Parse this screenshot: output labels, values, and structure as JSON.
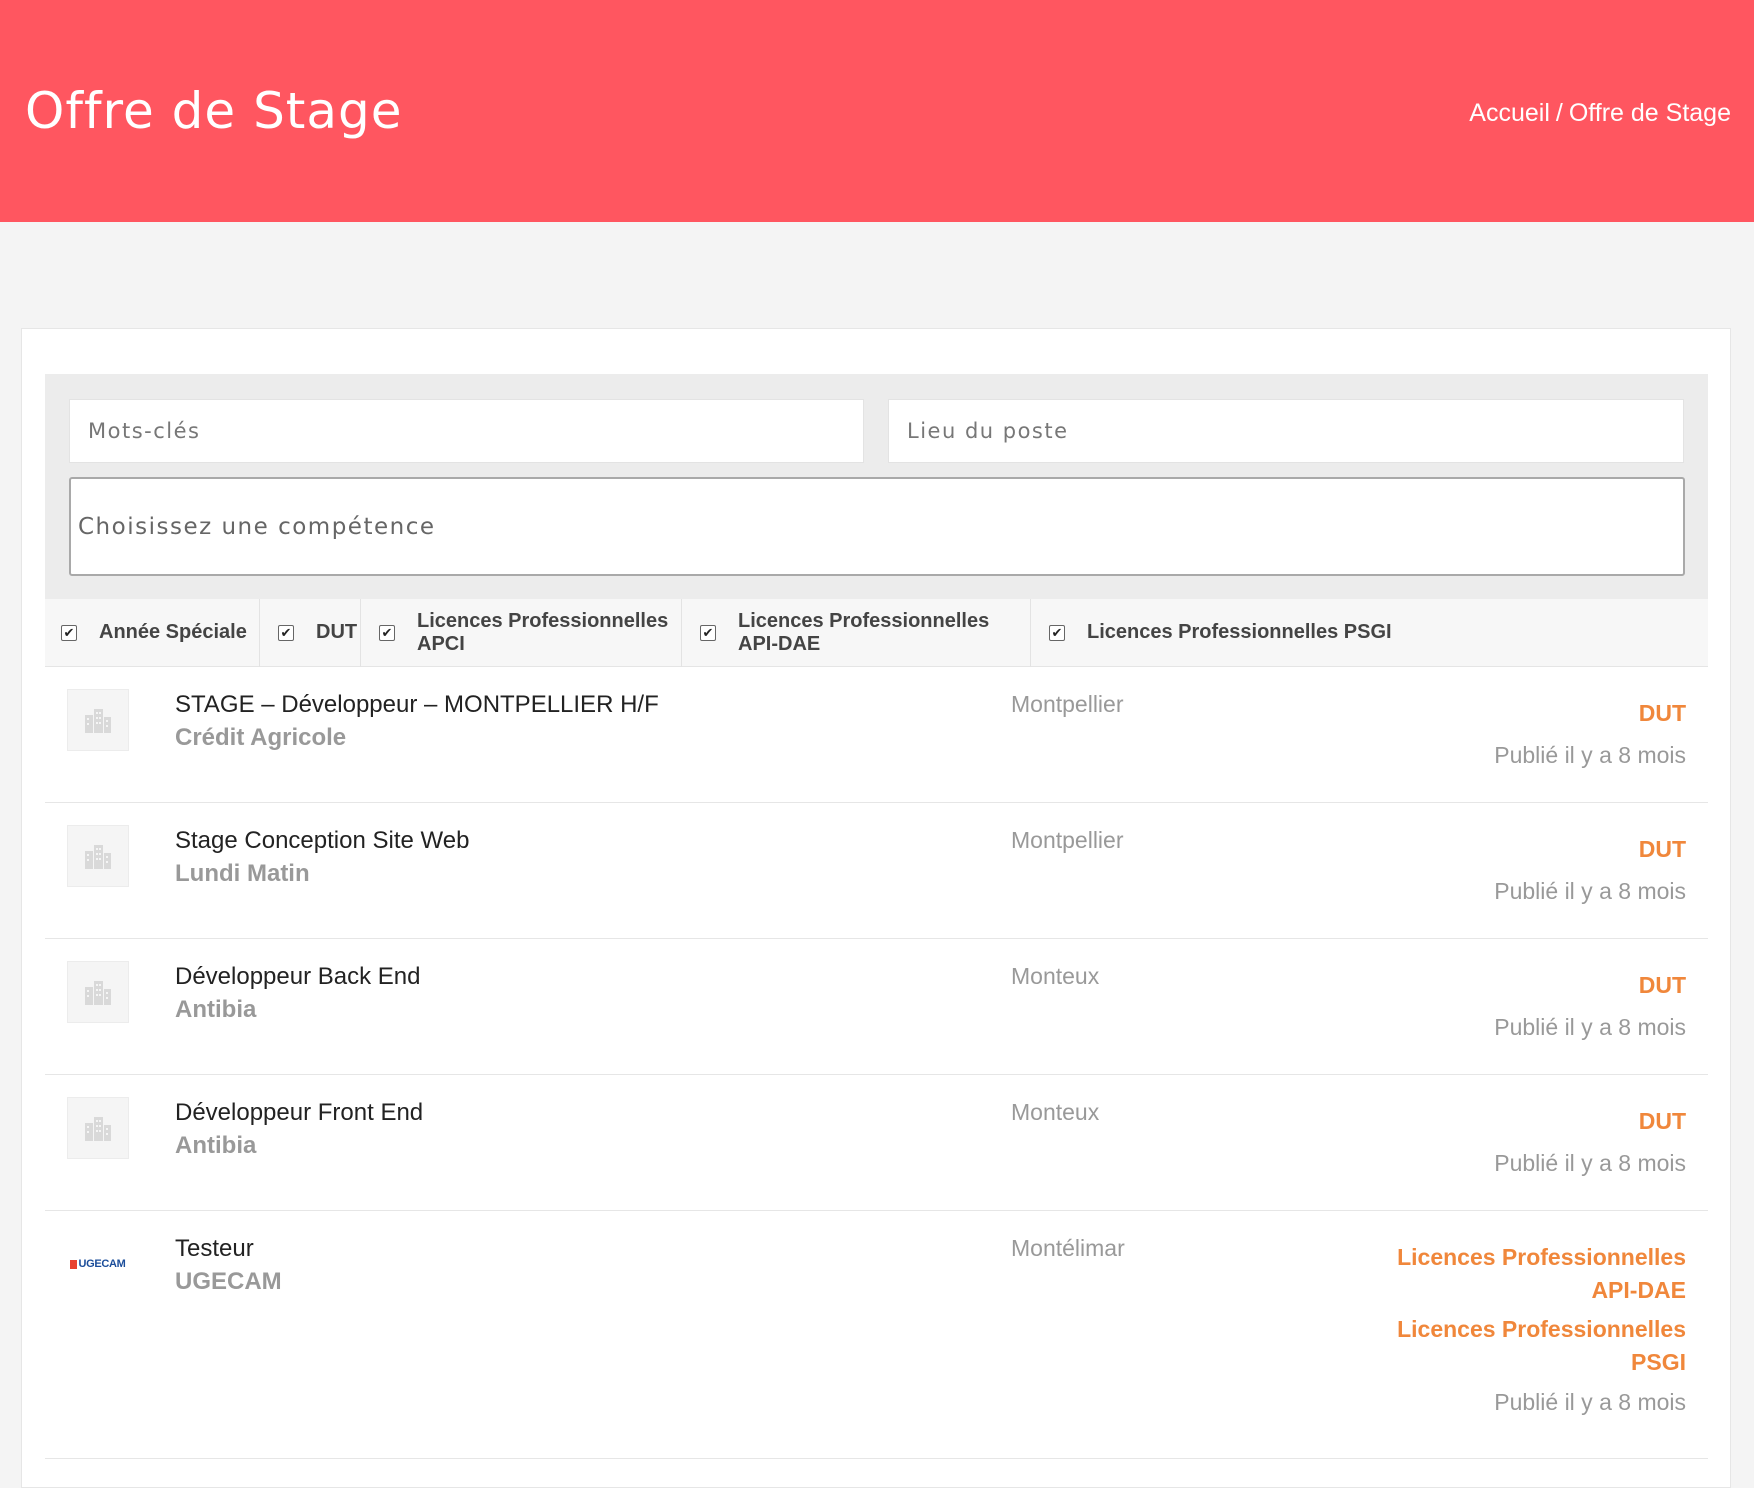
{
  "header": {
    "title": "Offre de Stage",
    "breadcrumb": {
      "home": "Accueil",
      "separator": "/",
      "current": "Offre de Stage"
    },
    "background_color": "#ff5660"
  },
  "search": {
    "keywords_placeholder": "Mots-clés",
    "location_placeholder": "Lieu du poste",
    "skill_placeholder": "Choisissez une compétence"
  },
  "filters": [
    {
      "label": "Année Spéciale",
      "checked": true
    },
    {
      "label": "DUT",
      "checked": true
    },
    {
      "label": "Licences Professionnelles APCI",
      "checked": true
    },
    {
      "label": "Licences Professionnelles API-DAE",
      "checked": true
    },
    {
      "label": "Licences Professionnelles PSGI",
      "checked": true
    }
  ],
  "jobs": [
    {
      "title": "STAGE – Développeur – MONTPELLIER H/F",
      "company": "Crédit Agricole",
      "location": "Montpellier",
      "tags": [
        "DUT"
      ],
      "published": "Publié il y a 8 mois",
      "logo": "building-icon"
    },
    {
      "title": "Stage Conception Site Web",
      "company": "Lundi Matin",
      "location": "Montpellier",
      "tags": [
        "DUT"
      ],
      "published": "Publié il y a 8 mois",
      "logo": "building-icon"
    },
    {
      "title": "Développeur Back End",
      "company": "Antibia",
      "location": "Monteux",
      "tags": [
        "DUT"
      ],
      "published": "Publié il y a 8 mois",
      "logo": "building-icon"
    },
    {
      "title": "Développeur Front End",
      "company": "Antibia",
      "location": "Monteux",
      "tags": [
        "DUT"
      ],
      "published": "Publié il y a 8 mois",
      "logo": "building-icon"
    },
    {
      "title": "Testeur",
      "company": "UGECAM",
      "location": "Montélimar",
      "tags": [
        "Licences Professionnelles API-DAE",
        "Licences Professionnelles PSGI"
      ],
      "published": "Publié il y a 8 mois",
      "logo": "ugecam-logo",
      "logo_text": "UGECAM"
    }
  ],
  "colors": {
    "accent_tag": "#f0873b",
    "muted_text": "#999999"
  }
}
